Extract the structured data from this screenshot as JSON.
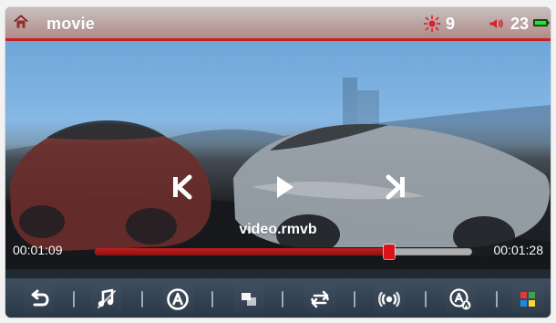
{
  "header": {
    "title": "movie",
    "brightness": {
      "icon": "brightness-icon",
      "value": "9"
    },
    "volume": {
      "icon": "volume-icon",
      "value": "23"
    },
    "battery": {
      "icon": "battery-icon"
    },
    "home": {
      "icon": "home-icon"
    }
  },
  "player": {
    "filename": "video.rmvb",
    "elapsed": "00:01:09",
    "total": "00:01:28",
    "progress_fraction": 0.78,
    "controls": [
      {
        "icon": "previous-icon"
      },
      {
        "icon": "play-icon"
      },
      {
        "icon": "next-icon"
      }
    ]
  },
  "toolbar": {
    "items": [
      {
        "icon": "back-icon"
      },
      {
        "icon": "music-icon"
      },
      {
        "icon": "a-icon"
      },
      {
        "icon": "layout-icon"
      },
      {
        "icon": "repeat-icon"
      },
      {
        "icon": "surround-icon"
      },
      {
        "icon": "ab-repeat-icon"
      },
      {
        "icon": "color-grid-icon"
      }
    ]
  },
  "colors": {
    "accent_red": "#c51f1f",
    "bar_dark": "#283644"
  }
}
